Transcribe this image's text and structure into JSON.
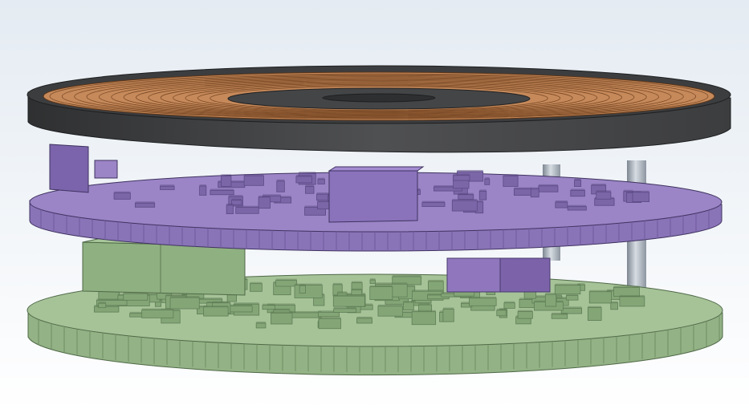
{
  "viewport": {
    "background_top": "#e4ebf2",
    "background_bottom": "#ffffff"
  },
  "model": {
    "coil_assembly": {
      "ferrite_color": "#4a4b4d",
      "ferrite_dark": "#2f3031",
      "winding_color": "#c6895a",
      "winding_line_color": "#7a4a26",
      "winding_turns": 14,
      "center_hole_color": "#3a3b3c"
    },
    "upper_board": {
      "pcb_color": "#8a74b8",
      "pcb_top_color": "#9b85c6",
      "edge_segment_color": "#6f5a9c",
      "component_color": "#7b66a8",
      "component_dark": "#5c4a84"
    },
    "lower_board": {
      "pcb_color": "#93b285",
      "pcb_top_color": "#a6c398",
      "edge_segment_color": "#6f8e63",
      "component_color": "#84a677",
      "component_dark": "#5f7d55",
      "connector_color": "#8fb081"
    },
    "standoffs": {
      "color": "#b3bcc6",
      "shadow_color": "#7d8691",
      "count": 2
    },
    "board_to_board_connector": {
      "color": "#8f76bd"
    }
  }
}
